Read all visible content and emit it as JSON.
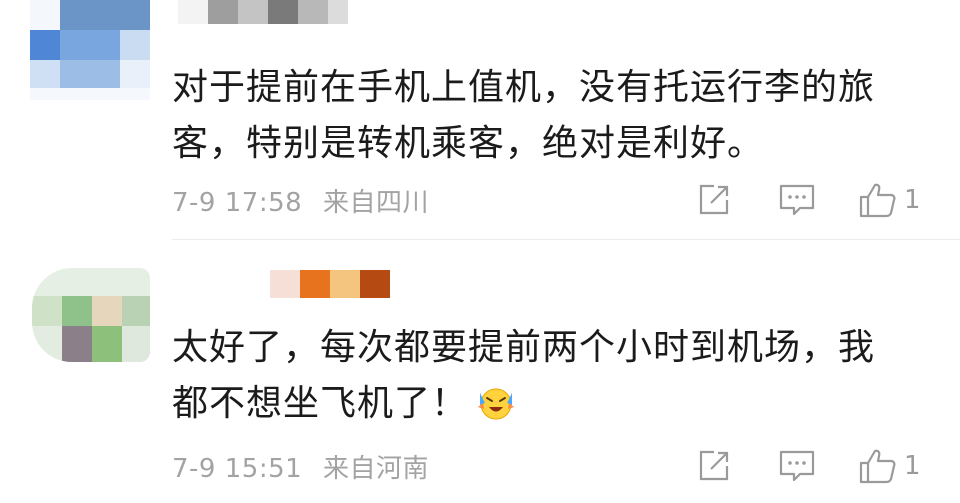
{
  "comments": [
    {
      "author_avatar": "blurred-avatar",
      "text_line1": "对于提前在手机上值机，没有托运行李的旅",
      "text_line2": "客，特别是转机乘客，绝对是利好。",
      "time": "7-9 17:58",
      "location": "来自四川",
      "likes": "1"
    },
    {
      "author_avatar": "blurred-avatar",
      "text_line1": "太好了，每次都要提前两个小时到机场，我",
      "text_line2": "都不想坐飞机了！",
      "emoji": "laughing-crying-face",
      "time": "7-9 15:51",
      "location": "来自河南",
      "likes": "1"
    }
  ],
  "icons": {
    "share": "share-icon",
    "comment": "comment-icon",
    "like": "thumbs-up-icon"
  },
  "colors": {
    "text": "#1b1b1b",
    "meta": "#a3a3a3",
    "icon": "#9a9a9a",
    "divider": "#ececec"
  }
}
